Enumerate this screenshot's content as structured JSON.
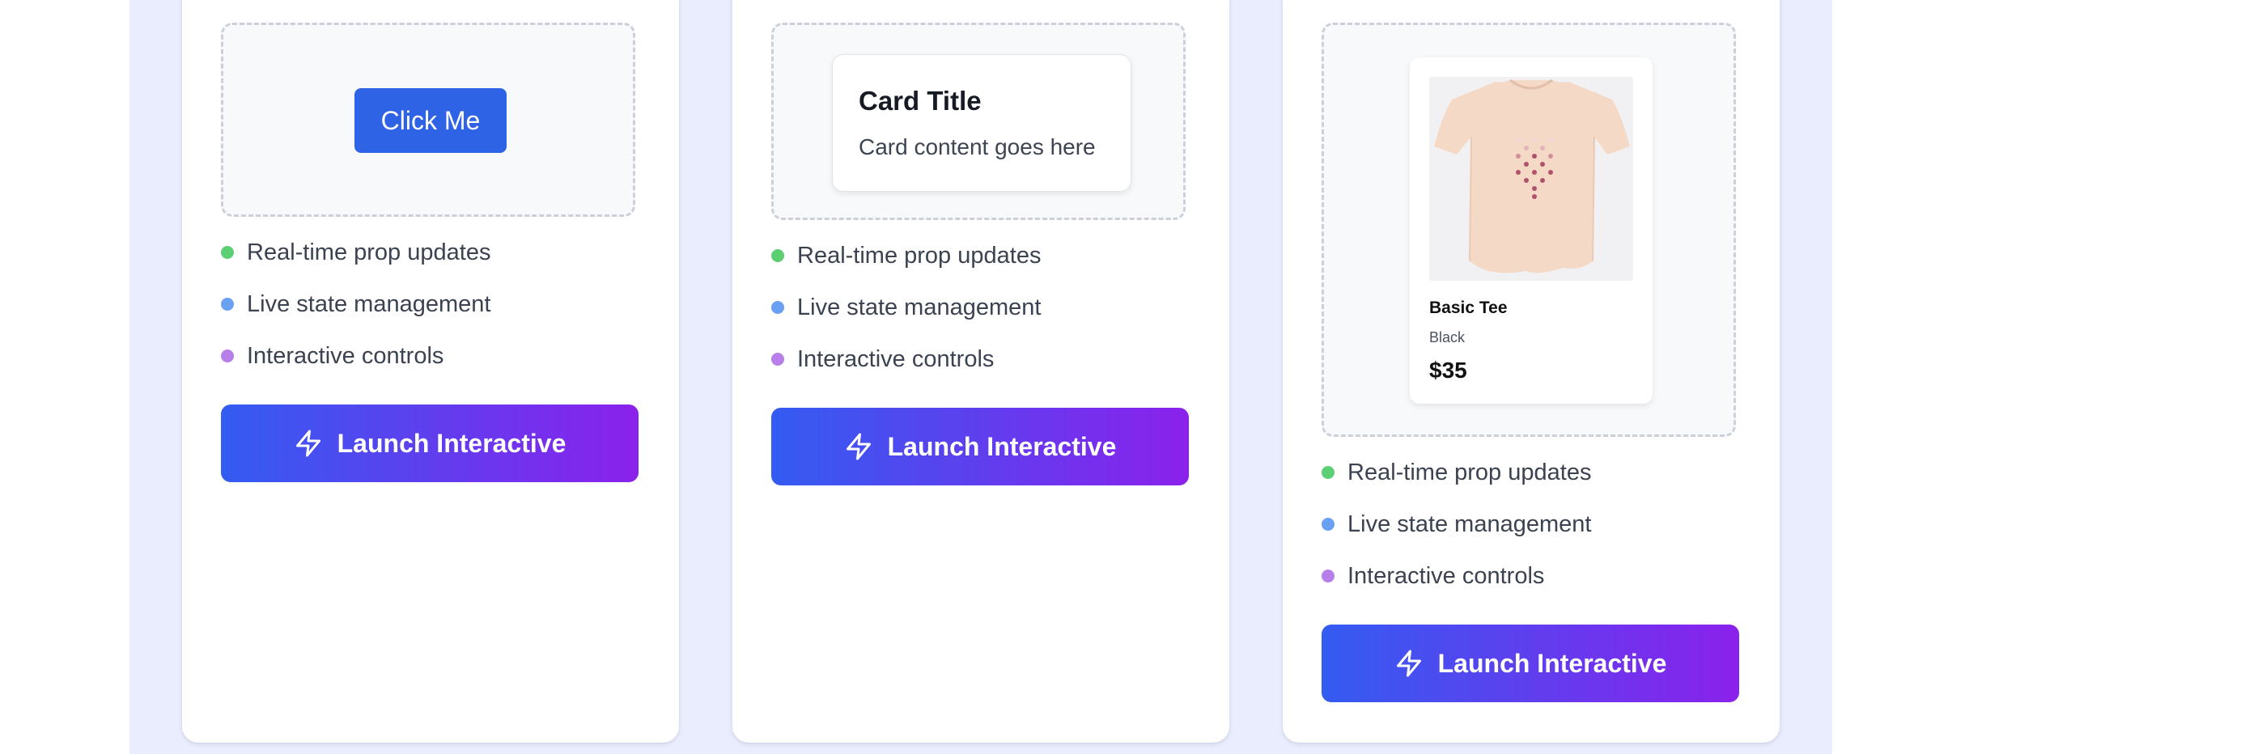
{
  "cards": [
    {
      "demo": {
        "button_label": "Click Me"
      },
      "features": [
        "Real-time prop updates",
        "Live state management",
        "Interactive controls"
      ],
      "launch_label": "Launch Interactive"
    },
    {
      "demo": {
        "card_title": "Card Title",
        "card_content": "Card content goes here"
      },
      "features": [
        "Real-time prop updates",
        "Live state management",
        "Interactive controls"
      ],
      "launch_label": "Launch Interactive"
    },
    {
      "demo": {
        "product_name": "Basic Tee",
        "product_color": "Black",
        "product_price": "$35",
        "product_image": "t-shirt-image"
      },
      "features": [
        "Real-time prop updates",
        "Live state management",
        "Interactive controls"
      ],
      "launch_label": "Launch Interactive"
    }
  ],
  "colors": {
    "panel_background": "#e9edfd",
    "button_blue": "#2f63e6",
    "gradient_start": "#335cf1",
    "gradient_end": "#8b21ec",
    "dot_green": "#5ccf73",
    "dot_blue": "#6aa0f2",
    "dot_purple": "#b87ee9"
  },
  "icons": {
    "launch": "lightning-bolt-icon"
  }
}
